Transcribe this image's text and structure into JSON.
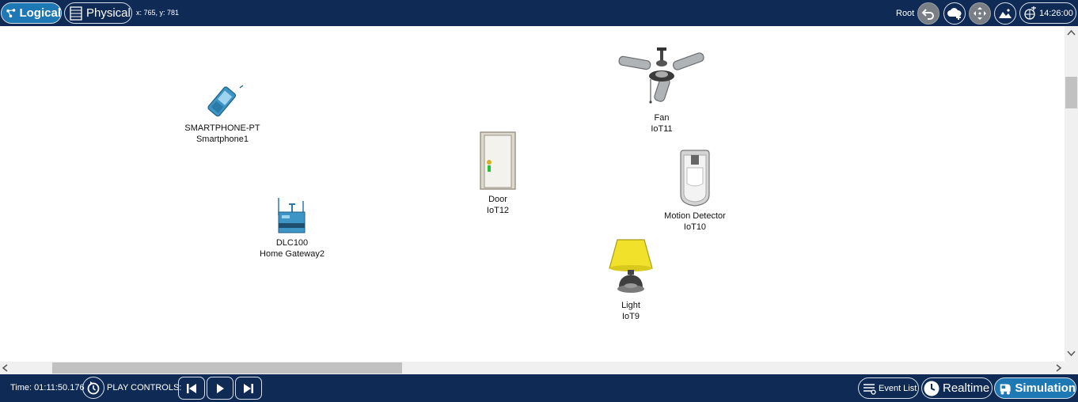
{
  "toolbar": {
    "logical_label": "Logical",
    "physical_label": "Physical",
    "coords": "x: 765, y: 781",
    "root_label": "Root",
    "clock": "14:26:00"
  },
  "devices": [
    {
      "model": "SMARTPHONE-PT",
      "name": "Smartphone1",
      "icon": "smartphone-icon"
    },
    {
      "model": "DLC100",
      "name": "Home Gateway2",
      "icon": "home-gateway-icon"
    },
    {
      "model": "Door",
      "name": "IoT12",
      "icon": "door-icon"
    },
    {
      "model": "Fan",
      "name": "IoT11",
      "icon": "ceiling-fan-icon"
    },
    {
      "model": "Motion Detector",
      "name": "IoT10",
      "icon": "motion-detector-icon"
    },
    {
      "model": "Light",
      "name": "IoT9",
      "icon": "lamp-icon"
    }
  ],
  "bottombar": {
    "time_label": "Time: 01:11:50.176",
    "play_controls_label": "PLAY CONTROLS:",
    "event_list_label": "Event List",
    "realtime_label": "Realtime",
    "simulation_label": "Simulation"
  },
  "colors": {
    "bar_background": "#0f2a54",
    "active_mode": "#1e78b4",
    "canvas": "#ffffff"
  }
}
